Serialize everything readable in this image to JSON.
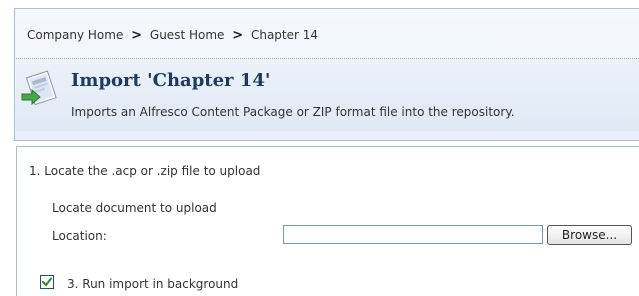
{
  "breadcrumb": {
    "items": [
      "Company Home",
      "Guest Home",
      "Chapter 14"
    ],
    "separator": ">"
  },
  "header": {
    "title": "Import 'Chapter 14'",
    "subtitle": "Imports an Alfresco Content Package or ZIP format file into the repository.",
    "icon": "import-icon"
  },
  "form": {
    "step1_label": "1. Locate the .acp or .zip file to upload",
    "locate_label": "Locate document to upload",
    "location_label": "Location:",
    "location_value": "",
    "browse_label": "Browse...",
    "background_label": "3. Run import in background",
    "background_checked": true
  },
  "colors": {
    "accent": "#1f3a5c",
    "border": "#a8bcd3",
    "header_bg": "#e7eff8",
    "checkmark": "#2e8b2e"
  }
}
